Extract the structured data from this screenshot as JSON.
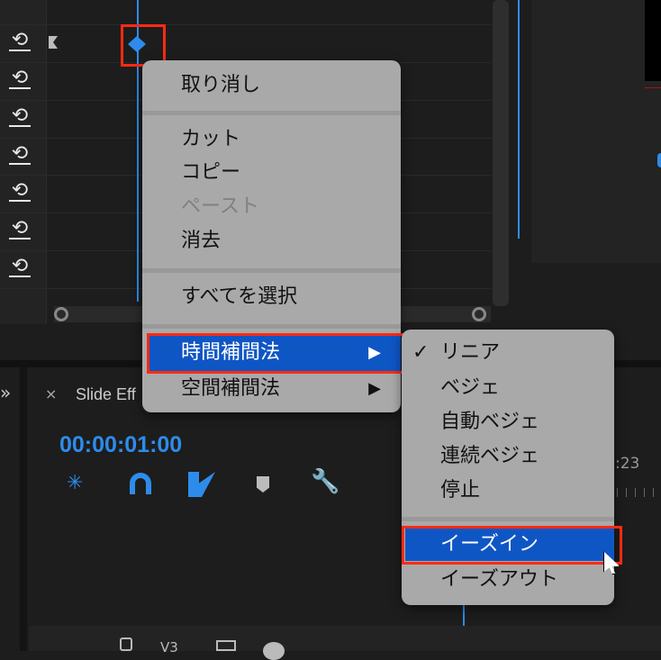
{
  "context_menu": {
    "items": [
      {
        "label": "取り消し"
      },
      {
        "label": "カット"
      },
      {
        "label": "コピー"
      },
      {
        "label": "ペースト",
        "disabled": true
      },
      {
        "label": "消去"
      },
      {
        "label": "すべてを選択"
      },
      {
        "label": "時間補間法",
        "submenu": true,
        "highlighted": true
      },
      {
        "label": "空間補間法",
        "submenu": true
      }
    ],
    "submenu_arrow": "▶"
  },
  "submenu": {
    "check": "✓",
    "items": [
      {
        "label": "リニア",
        "checked": true
      },
      {
        "label": "ベジェ"
      },
      {
        "label": "自動ベジェ"
      },
      {
        "label": "連続ベジェ"
      },
      {
        "label": "停止"
      },
      {
        "label": "イーズイン",
        "highlighted": true
      },
      {
        "label": "イーズアウト"
      }
    ]
  },
  "panel": {
    "tab_close": "×",
    "tab_label": "Slide Eff",
    "timecode": "00:00:01:00",
    "ruler_label": ":23",
    "track_label": "V3",
    "panel_chevron": "»"
  },
  "colors": {
    "accent": "#2d8ceb",
    "highlight": "#0f56c5",
    "annotation": "#ff2a13"
  }
}
